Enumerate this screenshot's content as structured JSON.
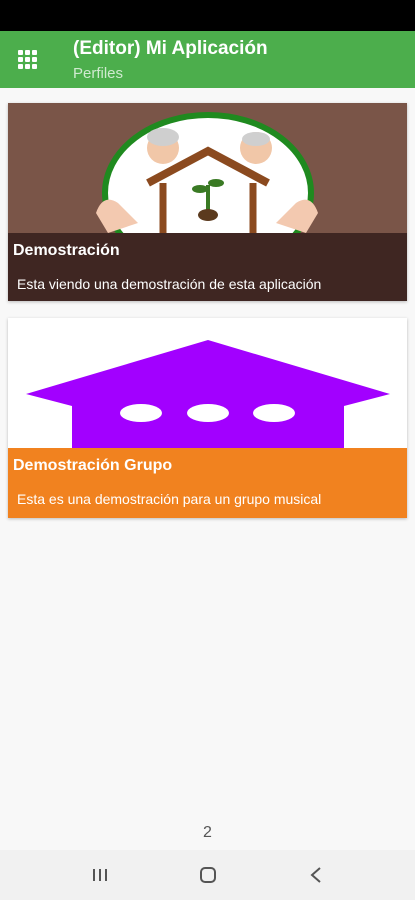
{
  "app_bar": {
    "title": "(Editor) Mi Aplicación",
    "subtitle": "Perfiles",
    "menu_icon": "grid-icon",
    "color": "#4cae4c"
  },
  "profiles": [
    {
      "title": "Demostración",
      "description": "Esta viendo una demostración de esta aplicación",
      "footer_color": "#3f2622",
      "image": "house-with-elderly-couple-logo"
    },
    {
      "title": "Demostración Grupo",
      "description": "Esta es una demostración para un grupo musical",
      "footer_color": "#f1821f",
      "image": "purple-house-logo"
    }
  ],
  "page_number": "2",
  "nav_bar": {
    "recents_icon": "recents-icon",
    "home_icon": "home-icon",
    "back_icon": "back-icon"
  }
}
